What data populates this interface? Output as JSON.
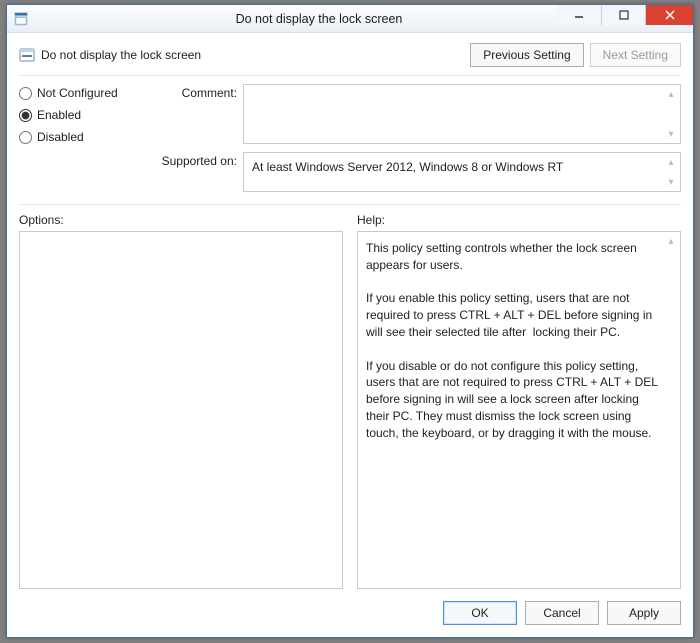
{
  "window": {
    "title": "Do not display the lock screen"
  },
  "header": {
    "policy_title": "Do not display the lock screen"
  },
  "nav": {
    "prev": "Previous Setting",
    "next": "Next Setting",
    "next_disabled": true
  },
  "radios": {
    "not_configured": "Not Configured",
    "enabled": "Enabled",
    "disabled": "Disabled",
    "selected": "enabled"
  },
  "labels": {
    "comment": "Comment:",
    "supported": "Supported on:",
    "options": "Options:",
    "help": "Help:"
  },
  "fields": {
    "comment": "",
    "supported": "At least Windows Server 2012, Windows 8 or Windows RT"
  },
  "help_text": "This policy setting controls whether the lock screen appears for users.\n\nIf you enable this policy setting, users that are not required to press CTRL + ALT + DEL before signing in will see their selected tile after  locking their PC.\n\nIf you disable or do not configure this policy setting, users that are not required to press CTRL + ALT + DEL before signing in will see a lock screen after locking their PC. They must dismiss the lock screen using touch, the keyboard, or by dragging it with the mouse.",
  "footer": {
    "ok": "OK",
    "cancel": "Cancel",
    "apply": "Apply"
  }
}
